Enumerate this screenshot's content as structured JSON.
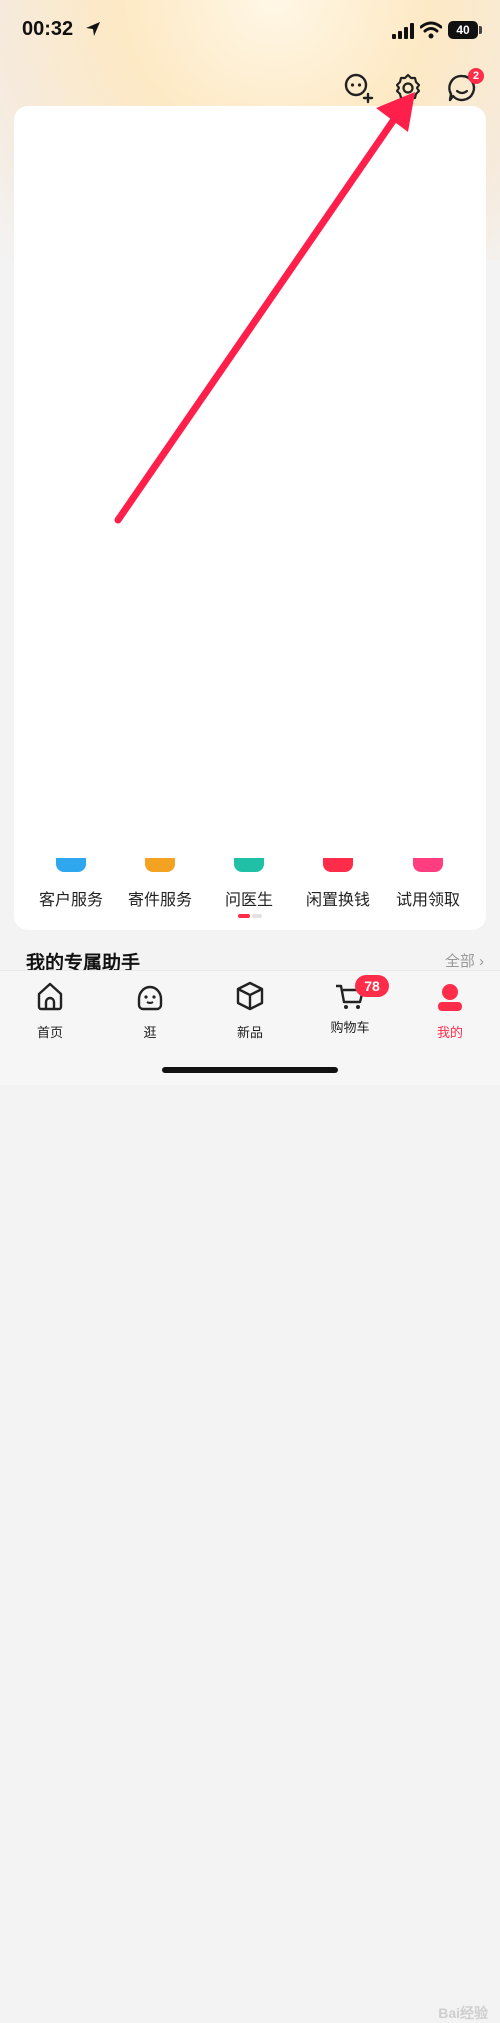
{
  "status_bar": {
    "time": "00:32",
    "battery": "40"
  },
  "header": {
    "messages_badge": "2"
  },
  "services": [
    {
      "label": "客户服务",
      "color": "#2ea7ef"
    },
    {
      "label": "寄件服务",
      "color": "#f3a321"
    },
    {
      "label": "问医生",
      "color": "#1fc0a6"
    },
    {
      "label": "闲置换钱",
      "color": "#ff2d4a"
    },
    {
      "label": "试用领取",
      "color": "#ff3d7f"
    }
  ],
  "assistant": {
    "title": "我的专属助手",
    "see_all": "全部 ›"
  },
  "tabs": [
    {
      "label": "首页",
      "icon": "home-icon"
    },
    {
      "label": "逛",
      "icon": "face-icon"
    },
    {
      "label": "新品",
      "icon": "box-icon"
    },
    {
      "label": "购物车",
      "icon": "cart-icon",
      "badge": "78"
    },
    {
      "label": "我的",
      "icon": "profile-icon",
      "active": true
    }
  ],
  "watermark": "Bai经验",
  "colors": {
    "accent": "#ff2d4a",
    "arrow": "#ff1f4b"
  }
}
